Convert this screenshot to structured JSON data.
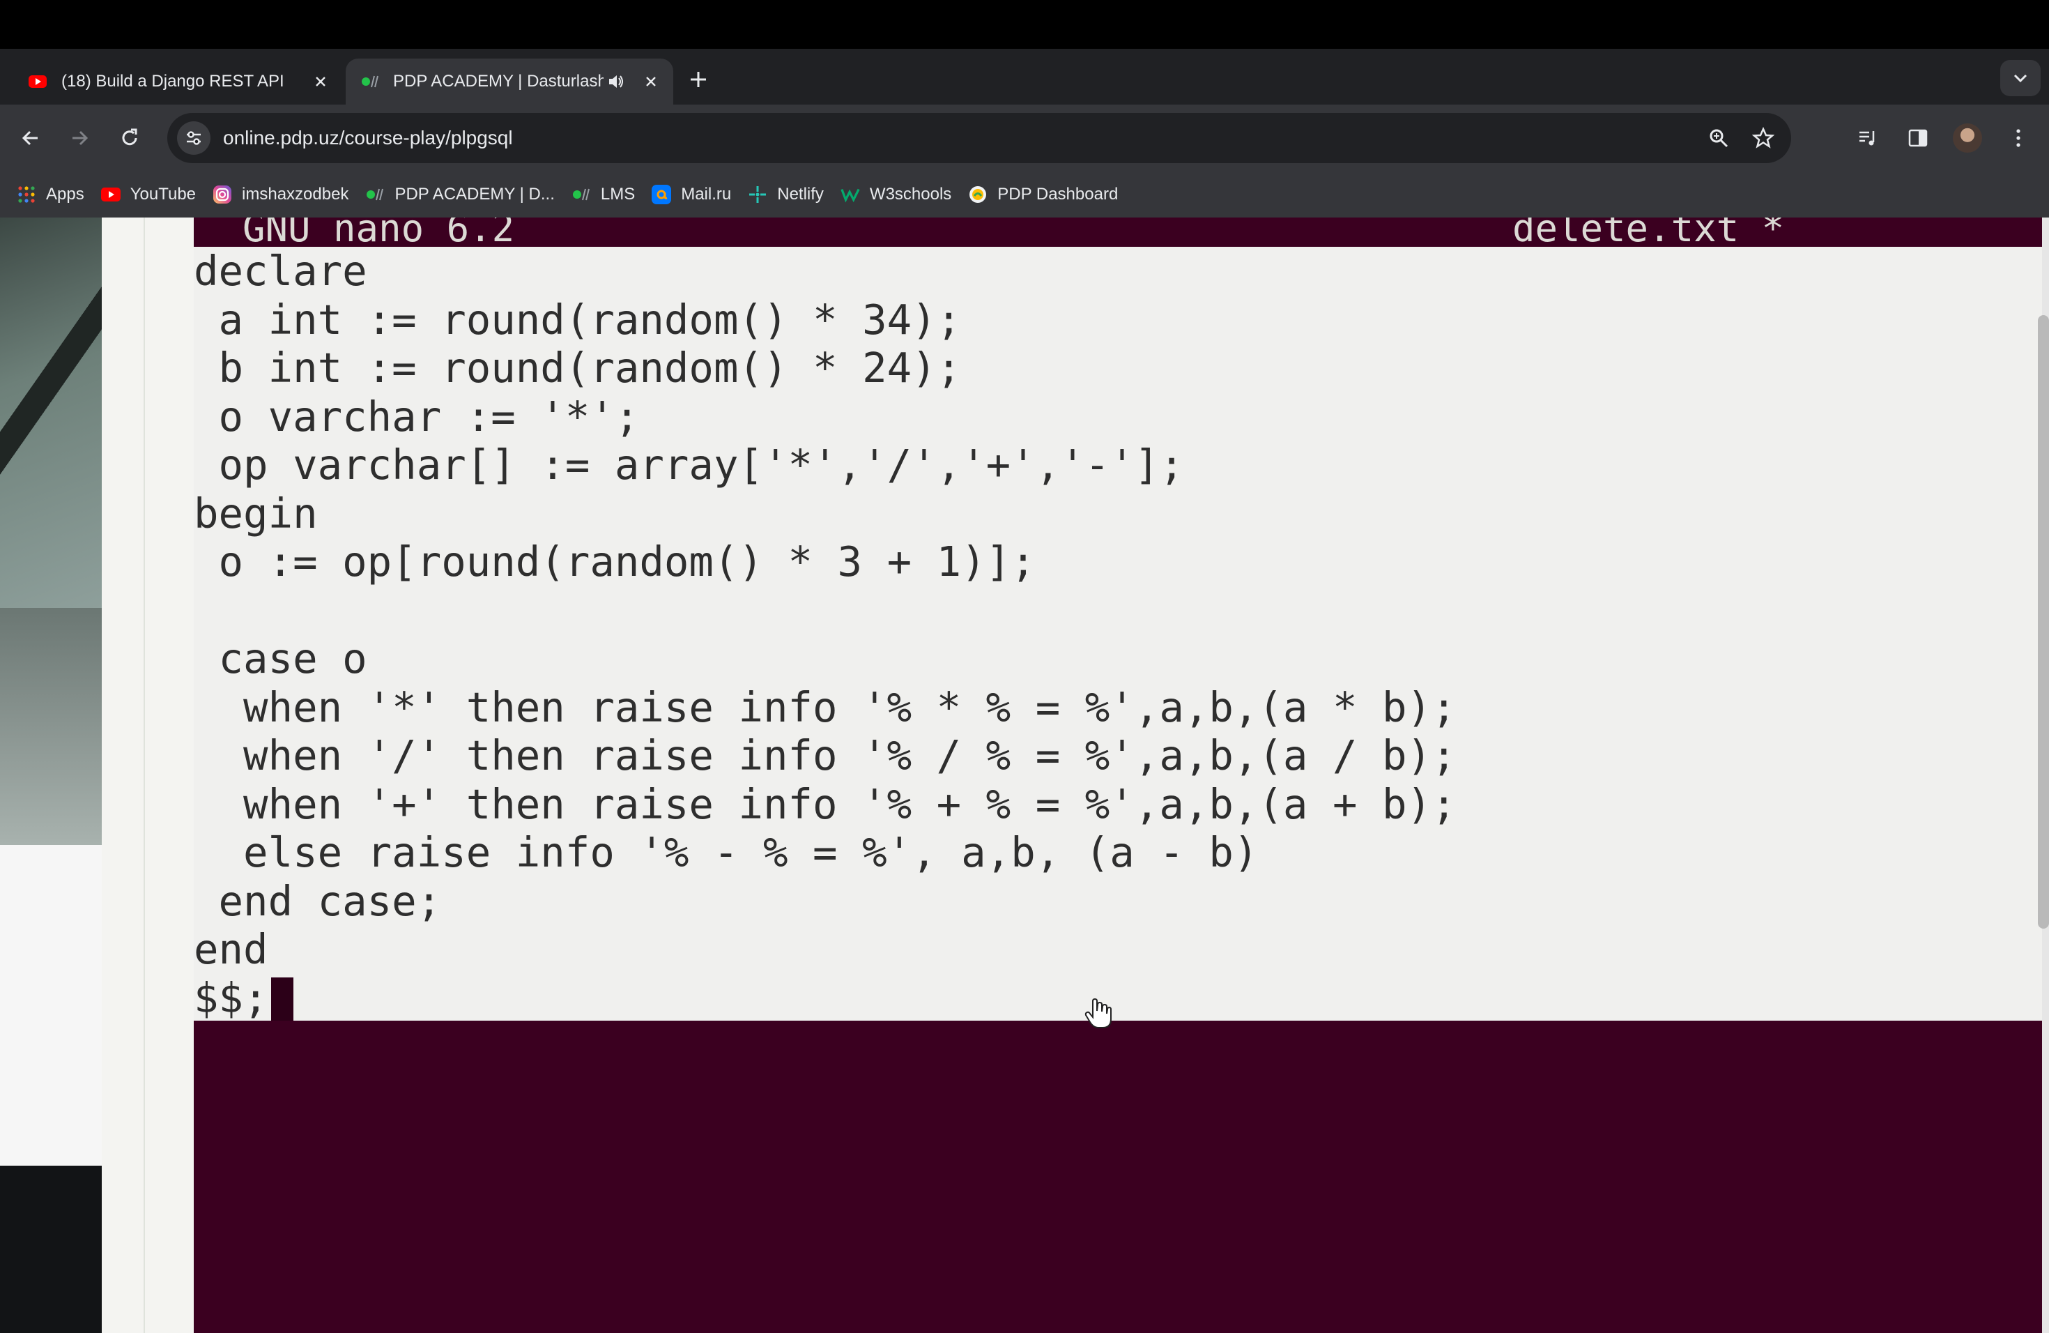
{
  "browser": {
    "tabs": [
      {
        "title": "(18) Build a Django REST API",
        "favicon": "youtube-icon",
        "active": false
      },
      {
        "title": "PDP ACADEMY | Dasturlash",
        "favicon": "pdp-favicon",
        "active": true,
        "audio": "speaker-icon"
      }
    ],
    "new_tab": "+",
    "url": "online.pdp.uz/course-play/plpgsql",
    "bookmarks": [
      {
        "label": "Apps",
        "icon": "apps-grid-icon"
      },
      {
        "label": "YouTube",
        "icon": "youtube-icon"
      },
      {
        "label": "imshaxzodbek",
        "icon": "instagram-icon"
      },
      {
        "label": "PDP ACADEMY | D...",
        "icon": "pdp-favicon"
      },
      {
        "label": "LMS",
        "icon": "pdp-favicon"
      },
      {
        "label": "Mail.ru",
        "icon": "mailru-icon"
      },
      {
        "label": "Netlify",
        "icon": "netlify-icon"
      },
      {
        "label": "W3schools",
        "icon": "w3schools-icon"
      },
      {
        "label": "PDP Dashboard",
        "icon": "pdp-dashboard-icon"
      }
    ],
    "colors": {
      "tabstrip": "#202124",
      "toolbar": "#35363a",
      "text": "#e8eaed"
    }
  },
  "terminal": {
    "title_left": "GNU nano 6.2",
    "title_right": "delete.txt *",
    "code": "declare\n a int := round(random() * 34);\n b int := round(random() * 24);\n o varchar := '*';\n op varchar[] := array['*','/','+','-'];\nbegin\n o := op[round(random() * 3 + 1)];\n\n case o\n  when '*' then raise info '% * % = %',a,b,(a * b);\n  when '/' then raise info '% / % = %',a,b,(a / b);\n  when '+' then raise info '% + % = %',a,b,(a + b);\n  else raise info '% - % = %', a,b, (a - b)\n end case;\nend\n$$;",
    "colors": {
      "background": "#3b0020",
      "editor": "#f0f0ee",
      "text": "#2e2e2e"
    }
  }
}
